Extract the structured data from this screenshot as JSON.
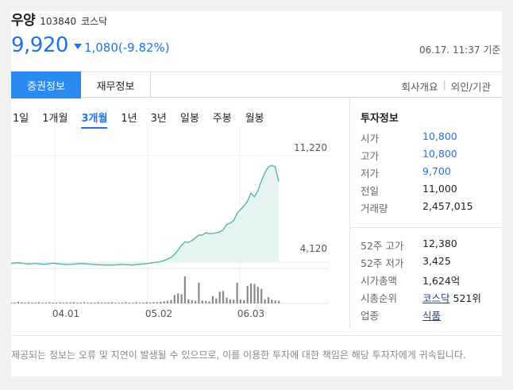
{
  "stock": {
    "name": "우양",
    "code": "103840",
    "market": "코스닥",
    "price": "9,920",
    "change": "1,080(-9.82%)",
    "timestamp": "06.17. 11:37 기준"
  },
  "tabs": {
    "active": "증권정보",
    "finance": "재무정보",
    "company": "회사개요",
    "foreign": "외인/기관"
  },
  "periods": [
    "1일",
    "1개월",
    "3개월",
    "1년",
    "3년",
    "일봉",
    "주봉",
    "월봉"
  ],
  "active_period": "3개월",
  "colors": {
    "accent": "#1e73e8",
    "area_fill": "#e6f4f1",
    "area_line": "#46b3a6",
    "volume_bar": "#888888"
  },
  "chart_data": {
    "type": "area",
    "x_ticks": [
      "04.01",
      "05.02",
      "06.03"
    ],
    "y_ticks": [
      "11,220",
      "4,120"
    ],
    "ylim": [
      4120,
      11220
    ],
    "price": [
      4450,
      4480,
      4500,
      4470,
      4430,
      4420,
      4440,
      4460,
      4430,
      4400,
      4410,
      4440,
      4470,
      4450,
      4420,
      4400,
      4380,
      4390,
      4410,
      4430,
      4450,
      4440,
      4420,
      4400,
      4380,
      4370,
      4360,
      4350,
      4340,
      4350,
      4360,
      4380,
      4390,
      4370,
      4360,
      4350,
      4380,
      4400,
      4420,
      4440,
      4470,
      4510,
      4540,
      4580,
      4650,
      4750,
      4850,
      5050,
      5350,
      5650,
      5900,
      5850,
      5980,
      6150,
      6350,
      6350,
      6500,
      6450,
      6450,
      6500,
      6550,
      6700,
      7050,
      7150,
      7300,
      7800,
      8050,
      8300,
      8600,
      9150,
      8900,
      9300,
      9950,
      10500,
      10900,
      11000,
      10900,
      9920
    ],
    "volume": [
      3,
      2,
      4,
      3,
      2,
      3,
      2,
      2,
      3,
      2,
      2,
      3,
      2,
      2,
      3,
      2,
      2,
      2,
      3,
      2,
      2,
      3,
      2,
      2,
      2,
      3,
      2,
      2,
      2,
      3,
      2,
      2,
      2,
      3,
      2,
      2,
      3,
      2,
      2,
      3,
      2,
      3,
      3,
      4,
      5,
      6,
      8,
      20,
      24,
      22,
      65,
      10,
      8,
      6,
      50,
      7,
      6,
      5,
      18,
      12,
      28,
      30,
      14,
      10,
      9,
      50,
      9,
      8,
      42,
      48,
      47,
      40,
      35,
      10,
      15,
      9,
      7,
      6
    ],
    "volume_max": 80
  },
  "info": {
    "title": "투자정보",
    "rows": [
      {
        "label": "시가",
        "value": "10,800"
      },
      {
        "label": "고가",
        "value": "10,800"
      },
      {
        "label": "저가",
        "value": "9,700"
      },
      {
        "label": "전일",
        "value": "11,000"
      },
      {
        "label": "거래량",
        "value": "2,457,015"
      }
    ],
    "rows2": [
      {
        "label": "52주 고가",
        "value": "12,380"
      },
      {
        "label": "52주 저가",
        "value": "3,425"
      },
      {
        "label": "시가총액",
        "value": "1,624억"
      },
      {
        "label": "시총순위",
        "link": "코스닥",
        "value": "521위"
      },
      {
        "label": "업종",
        "link": "식품"
      }
    ]
  },
  "disclaimer": "제공되는 정보는 오류 및 지연이 발생될 수 있으므로, 이를 이용한 투자에 대한 책임은 해당 투자자에게 귀속됩니다."
}
